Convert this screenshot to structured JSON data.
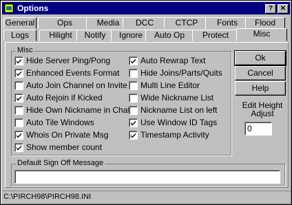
{
  "window": {
    "title": "Options"
  },
  "titlebar_buttons": {
    "help": "?",
    "close": "✕"
  },
  "tabs_row1": [
    "General",
    "Ops",
    "Media",
    "DCC",
    "CTCP",
    "Fonts",
    "Flood"
  ],
  "tabs_row2": [
    "Logs",
    "Hilight",
    "Notify",
    "Ignore",
    "Auto Op",
    "Protect",
    "Misc"
  ],
  "active_tab": "Misc",
  "misc_group": {
    "label": "Misc",
    "left_options": [
      {
        "label": "Hide Server Ping/Pong",
        "checked": true
      },
      {
        "label": "Enhanced Events Format",
        "checked": true
      },
      {
        "label": "Auto Join Channel on Invite",
        "checked": false
      },
      {
        "label": "Auto Rejoin if Kicked",
        "checked": true
      },
      {
        "label": "Hide Own Nickname in Chat",
        "checked": false
      },
      {
        "label": "Auto Tile Windows",
        "checked": false
      },
      {
        "label": "Whois On Private Msg",
        "checked": true
      },
      {
        "label": "Show member count",
        "checked": true
      }
    ],
    "right_options": [
      {
        "label": "Auto Rewrap Text",
        "checked": true
      },
      {
        "label": "Hide Joins/Parts/Quits",
        "checked": false
      },
      {
        "label": "Multi Line Editor",
        "checked": false
      },
      {
        "label": "Wide Nickname List",
        "checked": false
      },
      {
        "label": "Nickname List on left",
        "checked": false
      },
      {
        "label": "Use Window ID Tags",
        "checked": true
      },
      {
        "label": "Timestamp Activity",
        "checked": true
      }
    ]
  },
  "buttons": {
    "ok": "Ok",
    "cancel": "Cancel",
    "help": "Help"
  },
  "edit_height": {
    "label": "Edit Height Adjust",
    "value": "0"
  },
  "signoff": {
    "label": "Default Sign Off Message",
    "value": ""
  },
  "status": {
    "path": "C:\\PIRCH98\\PIRCH98.INI"
  }
}
